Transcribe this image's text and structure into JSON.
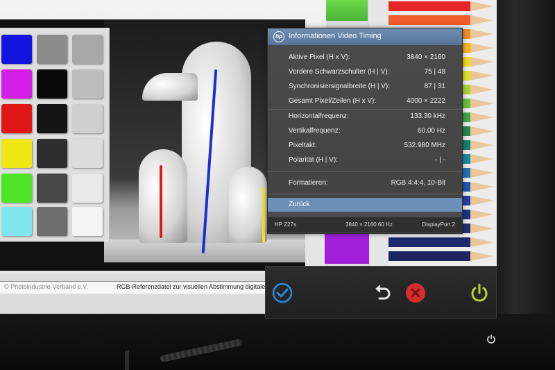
{
  "osd": {
    "title": "Informationen Video Timing",
    "logo_text": "hp",
    "rows": [
      {
        "label": "Aktive Pixel (H x V):",
        "value": "3840 × 2160"
      },
      {
        "label": "Vordere Schwarzschulter (H | V):",
        "value": "75 | 48"
      },
      {
        "label": "Synchronisiersignalbreite (H | V):",
        "value": "87 | 31"
      },
      {
        "label": "Gesamt Pixel/Zeilen (H x V):",
        "value": "4000 × 2222"
      },
      {
        "label": "Horizontalfrequenz:",
        "value": "133.30 kHz"
      },
      {
        "label": "Vertikalfrequenz:",
        "value": "60.00 Hz"
      },
      {
        "label": "Pixeltakt:",
        "value": "532.980 MHz"
      },
      {
        "label": "Polarität (H | V):",
        "value": "- | -"
      },
      {
        "label": "Formatieren:",
        "value": "RGB 4:4:4, 10-Bit"
      }
    ],
    "back_label": "Zurück",
    "footer": {
      "model": "HP Z27s",
      "resolution": "3840 × 2160  60 Hz",
      "input": "DisplayPort 2"
    },
    "colors": {
      "header": "#557495",
      "highlight": "#6c8fb8",
      "panel": "#4b4b4b"
    }
  },
  "controls": {
    "buttons": [
      {
        "name": "ok-check-icon",
        "color": "#2a8be0"
      },
      {
        "name": "back-arrow-icon",
        "color": "#e6e6e6"
      },
      {
        "name": "close-x-icon",
        "color": "#d82d2d"
      },
      {
        "name": "power-icon",
        "color": "#b6d330"
      }
    ]
  },
  "screen": {
    "caption_left": "© Photoindustrie-Verband e.V.",
    "caption_right": "RGB-Referenzdatei zur visuellen Abstimmung digitaler Au"
  }
}
